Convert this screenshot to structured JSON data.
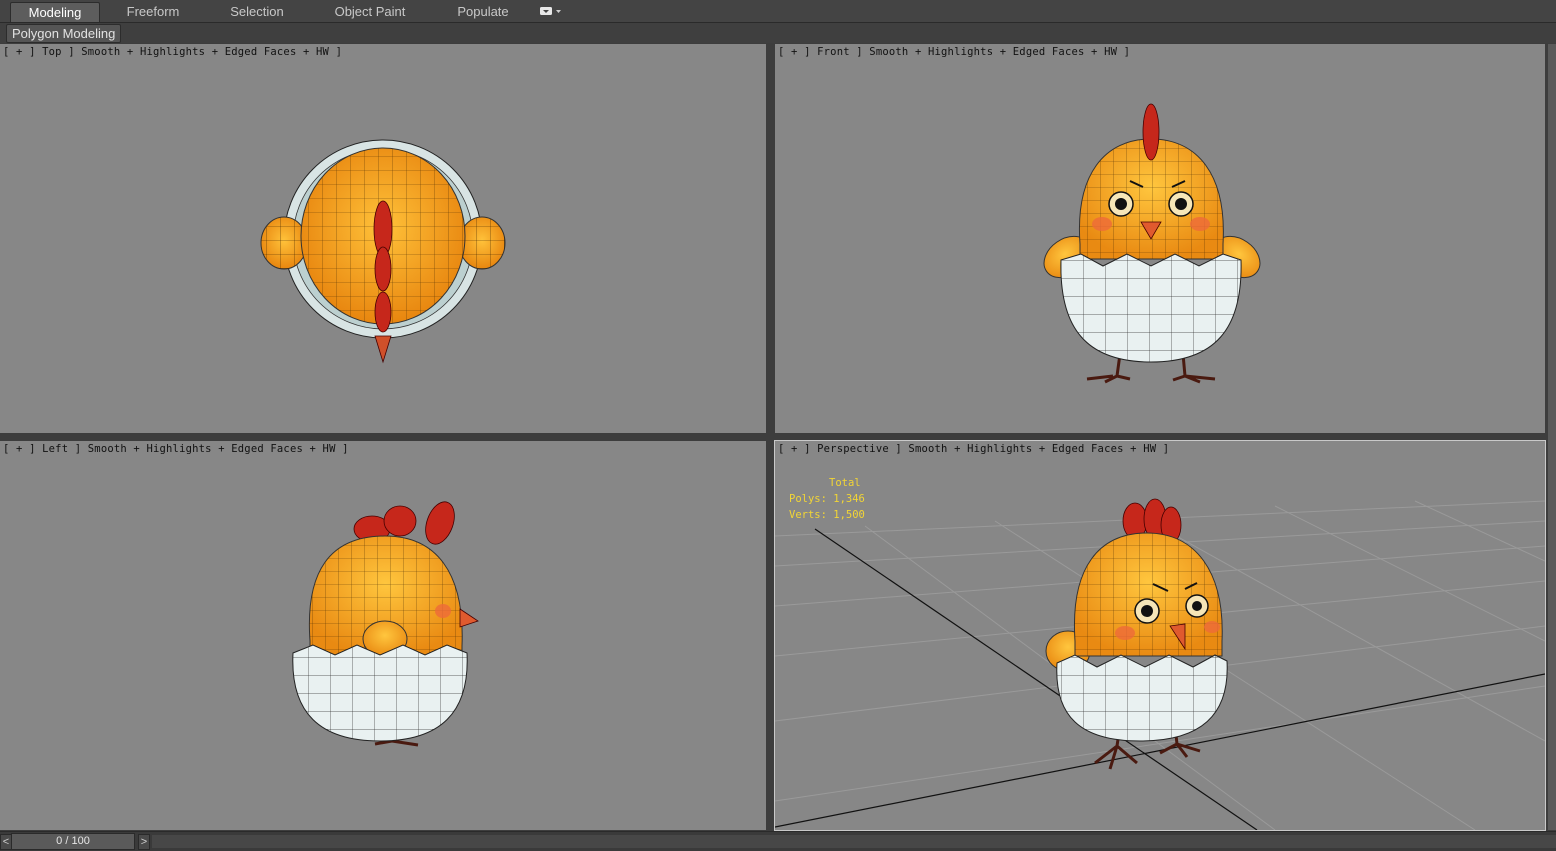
{
  "ribbon": {
    "tabs": [
      {
        "label": "Modeling",
        "active": true
      },
      {
        "label": "Freeform",
        "active": false
      },
      {
        "label": "Selection",
        "active": false
      },
      {
        "label": "Object Paint",
        "active": false
      },
      {
        "label": "Populate",
        "active": false
      }
    ],
    "options_icon": "ribbon-options-icon",
    "panel_label": "Polygon Modeling"
  },
  "viewports": {
    "top": {
      "label": "[ + ] Top ] Smooth + Highlights + Edged Faces + HW ]"
    },
    "front": {
      "label": "[ + ] Front ] Smooth + Highlights + Edged Faces + HW ]"
    },
    "left": {
      "label": "[ + ] Left ] Smooth + Highlights + Edged Faces + HW ]"
    },
    "perspective": {
      "label": "[ + ] Perspective ] Smooth + Highlights + Edged Faces + HW ]"
    }
  },
  "stats": {
    "title": "Total",
    "polys": "Polys: 1,346",
    "verts": "Verts: 1,500"
  },
  "timeline": {
    "prev_label": "<",
    "frame": "0 / 100",
    "next_label": ">"
  },
  "colors": {
    "viewport_bg": "#878787",
    "chick_body": "#f6a81e",
    "comb": "#cc2a1c",
    "shell": "#e9f1f1",
    "stats_text": "#f2d535"
  }
}
